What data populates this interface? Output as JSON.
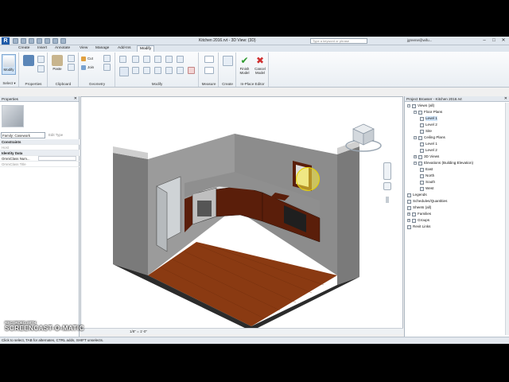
{
  "titlebar": {
    "app_logo": "R",
    "title": "Kitchen 2016.rvt - 3D View: {3D}",
    "search_placeholder": "Type a keyword or phrase",
    "user": "jgreene@wifu...",
    "controls": [
      "–",
      "□",
      "✕"
    ]
  },
  "tabs": [
    {
      "label": "Create",
      "active": false
    },
    {
      "label": "Insert",
      "active": false
    },
    {
      "label": "Annotate",
      "active": false
    },
    {
      "label": "View",
      "active": false
    },
    {
      "label": "Manage",
      "active": false
    },
    {
      "label": "Add-Ins",
      "active": false
    },
    {
      "label": "Modify",
      "active": true
    }
  ],
  "ribbon": {
    "select": {
      "button": "Modify",
      "panel": "Select ▾"
    },
    "properties": {
      "panel": "Properties"
    },
    "clipboard": {
      "paste": "Paste",
      "panel": "Clipboard"
    },
    "geometry": {
      "cut": "Cut",
      "join": "Join",
      "panel": "Geometry"
    },
    "modify": {
      "panel": "Modify"
    },
    "measure": {
      "panel": "Measure"
    },
    "create": {
      "panel": "Create"
    },
    "inplace": {
      "finish": "Finish Model",
      "cancel": "Cancel Model",
      "panel": "In-Place Editor"
    }
  },
  "properties_panel": {
    "title": "Properties",
    "family": "Family: Casework",
    "edit_type": "Edit Type",
    "rows": [
      {
        "label": "Constraints",
        "kind": "cat"
      },
      {
        "label": "Host",
        "kind": "dim"
      },
      {
        "label": "Identity Data",
        "kind": "cat"
      },
      {
        "label": "OmniClass Num...",
        "kind": "edit"
      },
      {
        "label": "OmniClass Title",
        "kind": "dim"
      }
    ]
  },
  "viewbar": {
    "scale": "1/8\" = 1'-0\""
  },
  "project_browser": {
    "title": "Project Browser - Kitchen 2016.rvt",
    "items": [
      {
        "label": "Views (all)",
        "depth": 0,
        "toggle": "−",
        "selected": false
      },
      {
        "label": "Floor Plans",
        "depth": 1,
        "toggle": "−",
        "selected": false
      },
      {
        "label": "Level 1",
        "depth": 2,
        "toggle": "",
        "selected": true
      },
      {
        "label": "Level 2",
        "depth": 2,
        "toggle": "",
        "selected": false
      },
      {
        "label": "Site",
        "depth": 2,
        "toggle": "",
        "selected": false
      },
      {
        "label": "Ceiling Plans",
        "depth": 1,
        "toggle": "−",
        "selected": false
      },
      {
        "label": "Level 1",
        "depth": 2,
        "toggle": "",
        "selected": false
      },
      {
        "label": "Level 2",
        "depth": 2,
        "toggle": "",
        "selected": false
      },
      {
        "label": "3D Views",
        "depth": 1,
        "toggle": "+",
        "selected": false
      },
      {
        "label": "Elevations (Building Elevation)",
        "depth": 1,
        "toggle": "−",
        "selected": false
      },
      {
        "label": "East",
        "depth": 2,
        "toggle": "",
        "selected": false
      },
      {
        "label": "North",
        "depth": 2,
        "toggle": "",
        "selected": false
      },
      {
        "label": "South",
        "depth": 2,
        "toggle": "",
        "selected": false
      },
      {
        "label": "West",
        "depth": 2,
        "toggle": "",
        "selected": false
      },
      {
        "label": "Legends",
        "depth": 0,
        "toggle": "",
        "selected": false
      },
      {
        "label": "Schedules/Quantities",
        "depth": 0,
        "toggle": "",
        "selected": false
      },
      {
        "label": "Sheets (all)",
        "depth": 0,
        "toggle": "",
        "selected": false
      },
      {
        "label": "Families",
        "depth": 0,
        "toggle": "+",
        "selected": false
      },
      {
        "label": "Groups",
        "depth": 0,
        "toggle": "+",
        "selected": false
      },
      {
        "label": "Revit Links",
        "depth": 0,
        "toggle": "",
        "selected": false
      }
    ]
  },
  "statusbar": {
    "text": "Click to select, TAB for alternates, CTRL adds, SHIFT unselects."
  },
  "watermark": {
    "top": "RECORDED WITH",
    "main": "SCREENCAST-O-MATIC"
  },
  "colors": {
    "accent": "#1e5aa8",
    "floor": "#8a3a12",
    "wall": "#8c8c8c",
    "cabinet": "#5a1e0a"
  }
}
